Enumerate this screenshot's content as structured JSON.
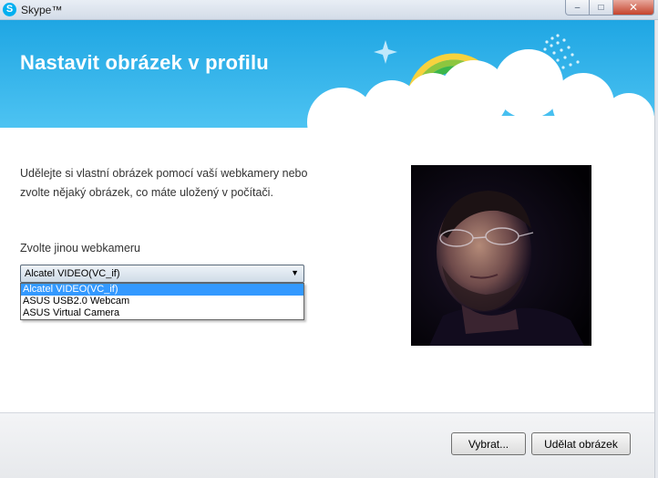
{
  "window": {
    "title": "Skype™",
    "logo_letter": "S",
    "controls": {
      "minimize": "–",
      "maximize": "□",
      "close": "✕"
    }
  },
  "header": {
    "title": "Nastavit obrázek v profilu"
  },
  "content": {
    "intro": "Udělejte si vlastní obrázek pomocí vaší webkamery nebo zvolte nějaký obrázek, co máte uložený v počítači.",
    "webcam_label": "Zvolte jinou webkameru",
    "webcam_select": {
      "value": "Alcatel VIDEO(VC_if)",
      "arrow": "▼",
      "options": [
        "Alcatel VIDEO(VC_if)",
        "ASUS USB2.0 Webcam",
        "ASUS Virtual Camera"
      ]
    }
  },
  "footer": {
    "choose_button": "Vybrat...",
    "snapshot_button": "Udělat obrázek"
  },
  "colors": {
    "header_blue": "#1fa6e3",
    "selected_option": "#3399ff"
  }
}
